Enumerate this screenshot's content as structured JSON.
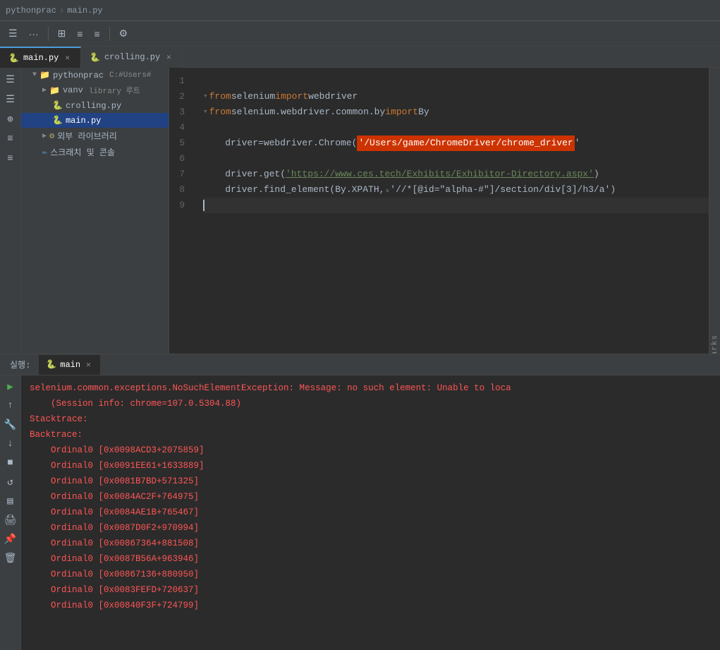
{
  "breadcrumb": {
    "items": [
      "pythonprac",
      "main.py"
    ]
  },
  "toolbar": {
    "buttons": [
      "☰",
      "...",
      "⊞",
      "≡",
      "≡",
      "⚙"
    ]
  },
  "tabs": [
    {
      "label": "main.py",
      "icon": "🐍",
      "active": true,
      "closeable": true
    },
    {
      "label": "crolling.py",
      "icon": "🐍",
      "active": false,
      "closeable": true
    }
  ],
  "file_tree": {
    "root": "pythonprac",
    "root_path": "C:#Users#",
    "items": [
      {
        "indent": 1,
        "type": "folder",
        "label": "vanv",
        "suffix": "library 루트",
        "expanded": false
      },
      {
        "indent": 2,
        "type": "py",
        "label": "crolling.py"
      },
      {
        "indent": 2,
        "type": "py",
        "label": "main.py",
        "selected": true
      },
      {
        "indent": 1,
        "type": "folder-ext",
        "label": "외부 라이브러리",
        "expanded": false
      },
      {
        "indent": 1,
        "type": "scratch",
        "label": "스크래치 및 콘솔"
      }
    ]
  },
  "code": {
    "lines": [
      {
        "num": 1,
        "content": ""
      },
      {
        "num": 2,
        "tokens": [
          {
            "type": "fold",
            "text": "▾"
          },
          {
            "type": "kw",
            "text": "from"
          },
          {
            "type": "plain",
            "text": " selenium "
          },
          {
            "type": "kw",
            "text": "import"
          },
          {
            "type": "plain",
            "text": " webdriver"
          }
        ]
      },
      {
        "num": 3,
        "tokens": [
          {
            "type": "fold",
            "text": "▾"
          },
          {
            "type": "kw",
            "text": "from"
          },
          {
            "type": "plain",
            "text": " selenium.webdriver.common.by "
          },
          {
            "type": "kw",
            "text": "import"
          },
          {
            "type": "plain",
            "text": " By"
          }
        ]
      },
      {
        "num": 4,
        "content": ""
      },
      {
        "num": 5,
        "tokens": [
          {
            "type": "plain",
            "text": "    driver "
          },
          {
            "type": "eq",
            "text": "="
          },
          {
            "type": "plain",
            "text": " webdriver.Chrome("
          },
          {
            "type": "highlight",
            "text": "'/Users/game/ChromeDriver/chrome_driver"
          },
          {
            "type": "plain",
            "text": "'"
          }
        ]
      },
      {
        "num": 6,
        "content": ""
      },
      {
        "num": 7,
        "tokens": [
          {
            "type": "plain",
            "text": "    driver.get("
          },
          {
            "type": "url",
            "text": "'https://www.ces.tech/Exhibits/Exhibitor-Directory.aspx'"
          },
          {
            "type": "plain",
            "text": ")"
          }
        ]
      },
      {
        "num": 8,
        "tokens": [
          {
            "type": "plain",
            "text": "    driver.find_element(By.XPATH,"
          },
          {
            "type": "plain",
            "text": " '//*[@id=\"alpha-#\"]/section/div[3]/h3/a')"
          }
        ]
      },
      {
        "num": 9,
        "content": "",
        "cursor": true
      }
    ]
  },
  "bottom_panel": {
    "run_label": "실행:",
    "tab_label": "main",
    "error_lines": [
      "selenium.common.exceptions.NoSuchElementException: Message: no such element: Unable to loca",
      "    (Session info: chrome=107.0.5304.88)",
      "Stacktrace:",
      "Backtrace:",
      "    Ordinal0 [0x0098ACD3+2075859]",
      "    Ordinal0 [0x0091EE61+1633889]",
      "    Ordinal0 [0x0081B7BD+571325]",
      "    Ordinal0 [0x0084AC2F+764975]",
      "    Ordinal0 [0x0084AE1B+765467]",
      "    Ordinal0 [0x0087D0F2+970994]",
      "    Ordinal0 [0x00867364+881508]",
      "    Ordinal0 [0x0087B56A+963946]",
      "    Ordinal0 [0x00867136+880950]",
      "    Ordinal0 [0x0083FEFD+720637]",
      "    Ordinal0 [0x00840F3F+724799]"
    ]
  },
  "bookmarks_label": "Bookmarks",
  "side_icons": [
    "☰",
    "☰",
    "⊕",
    "≡",
    "≡"
  ],
  "bottom_tool_icons": {
    "play": "▶",
    "up": "↑",
    "wrench": "🔧",
    "down": "↓",
    "stop": "■",
    "rerun": "↻",
    "stack": "▤",
    "print": "🖨",
    "pin": "📌",
    "trash": "🗑"
  }
}
